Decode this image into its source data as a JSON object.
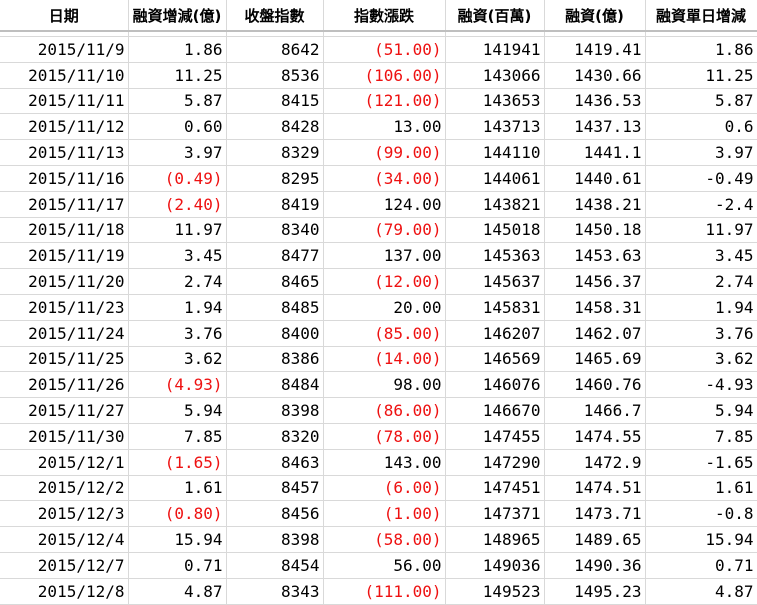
{
  "colors": {
    "negative": "#ee1111",
    "text": "#000000",
    "grid": "#d9d9d9"
  },
  "columns": [
    "日期",
    "融資增減(億)",
    "收盤指數",
    "指數漲跌",
    "融資(百萬)",
    "融資(億)",
    "融資單日增減"
  ],
  "rows": [
    {
      "date": "2015/11/9",
      "change": "1.86",
      "change_neg": false,
      "index": "8642",
      "index_change": "(51.00)",
      "index_change_neg": true,
      "margin_m": "141941",
      "margin_yi": "1419.41",
      "daily": "1.86"
    },
    {
      "date": "2015/11/10",
      "change": "11.25",
      "change_neg": false,
      "index": "8536",
      "index_change": "(106.00)",
      "index_change_neg": true,
      "margin_m": "143066",
      "margin_yi": "1430.66",
      "daily": "11.25"
    },
    {
      "date": "2015/11/11",
      "change": "5.87",
      "change_neg": false,
      "index": "8415",
      "index_change": "(121.00)",
      "index_change_neg": true,
      "margin_m": "143653",
      "margin_yi": "1436.53",
      "daily": "5.87"
    },
    {
      "date": "2015/11/12",
      "change": "0.60",
      "change_neg": false,
      "index": "8428",
      "index_change": "13.00",
      "index_change_neg": false,
      "margin_m": "143713",
      "margin_yi": "1437.13",
      "daily": "0.6"
    },
    {
      "date": "2015/11/13",
      "change": "3.97",
      "change_neg": false,
      "index": "8329",
      "index_change": "(99.00)",
      "index_change_neg": true,
      "margin_m": "144110",
      "margin_yi": "1441.1",
      "daily": "3.97"
    },
    {
      "date": "2015/11/16",
      "change": "(0.49)",
      "change_neg": true,
      "index": "8295",
      "index_change": "(34.00)",
      "index_change_neg": true,
      "margin_m": "144061",
      "margin_yi": "1440.61",
      "daily": "-0.49"
    },
    {
      "date": "2015/11/17",
      "change": "(2.40)",
      "change_neg": true,
      "index": "8419",
      "index_change": "124.00",
      "index_change_neg": false,
      "margin_m": "143821",
      "margin_yi": "1438.21",
      "daily": "-2.4"
    },
    {
      "date": "2015/11/18",
      "change": "11.97",
      "change_neg": false,
      "index": "8340",
      "index_change": "(79.00)",
      "index_change_neg": true,
      "margin_m": "145018",
      "margin_yi": "1450.18",
      "daily": "11.97"
    },
    {
      "date": "2015/11/19",
      "change": "3.45",
      "change_neg": false,
      "index": "8477",
      "index_change": "137.00",
      "index_change_neg": false,
      "margin_m": "145363",
      "margin_yi": "1453.63",
      "daily": "3.45"
    },
    {
      "date": "2015/11/20",
      "change": "2.74",
      "change_neg": false,
      "index": "8465",
      "index_change": "(12.00)",
      "index_change_neg": true,
      "margin_m": "145637",
      "margin_yi": "1456.37",
      "daily": "2.74"
    },
    {
      "date": "2015/11/23",
      "change": "1.94",
      "change_neg": false,
      "index": "8485",
      "index_change": "20.00",
      "index_change_neg": false,
      "margin_m": "145831",
      "margin_yi": "1458.31",
      "daily": "1.94"
    },
    {
      "date": "2015/11/24",
      "change": "3.76",
      "change_neg": false,
      "index": "8400",
      "index_change": "(85.00)",
      "index_change_neg": true,
      "margin_m": "146207",
      "margin_yi": "1462.07",
      "daily": "3.76"
    },
    {
      "date": "2015/11/25",
      "change": "3.62",
      "change_neg": false,
      "index": "8386",
      "index_change": "(14.00)",
      "index_change_neg": true,
      "margin_m": "146569",
      "margin_yi": "1465.69",
      "daily": "3.62"
    },
    {
      "date": "2015/11/26",
      "change": "(4.93)",
      "change_neg": true,
      "index": "8484",
      "index_change": "98.00",
      "index_change_neg": false,
      "margin_m": "146076",
      "margin_yi": "1460.76",
      "daily": "-4.93"
    },
    {
      "date": "2015/11/27",
      "change": "5.94",
      "change_neg": false,
      "index": "8398",
      "index_change": "(86.00)",
      "index_change_neg": true,
      "margin_m": "146670",
      "margin_yi": "1466.7",
      "daily": "5.94"
    },
    {
      "date": "2015/11/30",
      "change": "7.85",
      "change_neg": false,
      "index": "8320",
      "index_change": "(78.00)",
      "index_change_neg": true,
      "margin_m": "147455",
      "margin_yi": "1474.55",
      "daily": "7.85"
    },
    {
      "date": "2015/12/1",
      "change": "(1.65)",
      "change_neg": true,
      "index": "8463",
      "index_change": "143.00",
      "index_change_neg": false,
      "margin_m": "147290",
      "margin_yi": "1472.9",
      "daily": "-1.65"
    },
    {
      "date": "2015/12/2",
      "change": "1.61",
      "change_neg": false,
      "index": "8457",
      "index_change": "(6.00)",
      "index_change_neg": true,
      "margin_m": "147451",
      "margin_yi": "1474.51",
      "daily": "1.61"
    },
    {
      "date": "2015/12/3",
      "change": "(0.80)",
      "change_neg": true,
      "index": "8456",
      "index_change": "(1.00)",
      "index_change_neg": true,
      "margin_m": "147371",
      "margin_yi": "1473.71",
      "daily": "-0.8"
    },
    {
      "date": "2015/12/4",
      "change": "15.94",
      "change_neg": false,
      "index": "8398",
      "index_change": "(58.00)",
      "index_change_neg": true,
      "margin_m": "148965",
      "margin_yi": "1489.65",
      "daily": "15.94"
    },
    {
      "date": "2015/12/7",
      "change": "0.71",
      "change_neg": false,
      "index": "8454",
      "index_change": "56.00",
      "index_change_neg": false,
      "margin_m": "149036",
      "margin_yi": "1490.36",
      "daily": "0.71"
    },
    {
      "date": "2015/12/8",
      "change": "4.87",
      "change_neg": false,
      "index": "8343",
      "index_change": "(111.00)",
      "index_change_neg": true,
      "margin_m": "149523",
      "margin_yi": "1495.23",
      "daily": "4.87"
    }
  ]
}
